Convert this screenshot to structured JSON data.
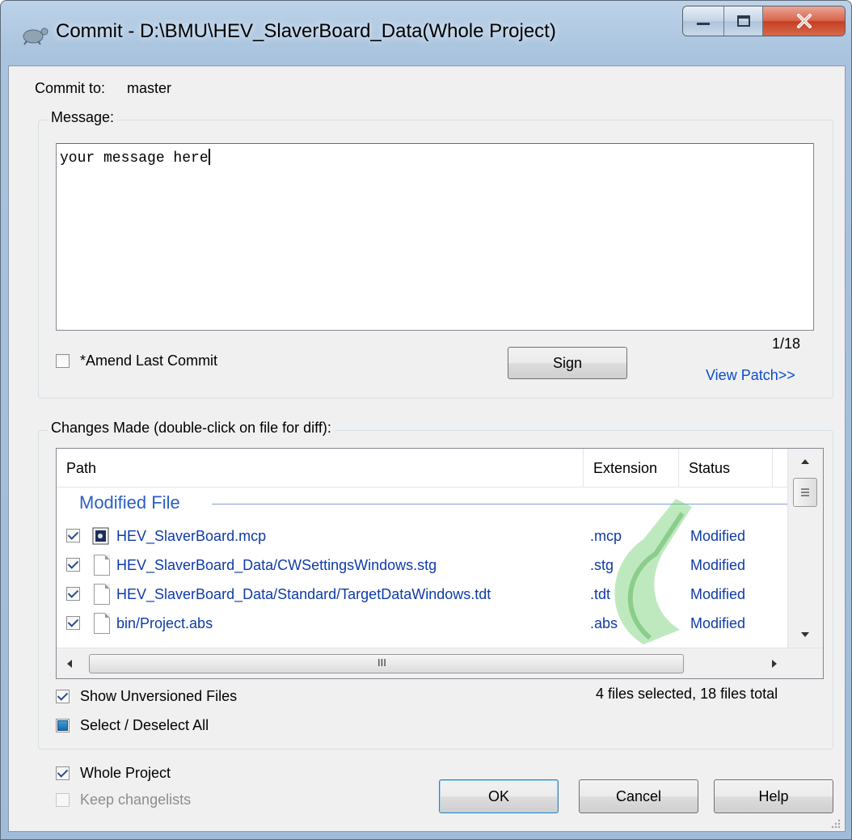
{
  "window": {
    "title": "Commit - D:\\BMU\\HEV_SlaverBoard_Data(Whole Project)",
    "minimize_glyph": "—",
    "maximize_glyph": "□",
    "close_glyph": "✕"
  },
  "commit_to": {
    "label": "Commit to:",
    "value": "master"
  },
  "message": {
    "group_label": "Message:",
    "value": "your message here",
    "counter": "1/18"
  },
  "amend": {
    "label": "*Amend Last Commit",
    "checked": false
  },
  "sign_button": "Sign",
  "view_patch": "View Patch>>",
  "changes": {
    "group_label": "Changes Made (double-click on file for diff):",
    "columns": [
      "Path",
      "Extension",
      "Status"
    ],
    "section_header": "Modified File",
    "rows": [
      {
        "checked": true,
        "path": "HEV_SlaverBoard.mcp",
        "extension": ".mcp",
        "status": "Modified",
        "icon": "project-file-icon"
      },
      {
        "checked": true,
        "path": "HEV_SlaverBoard_Data/CWSettingsWindows.stg",
        "extension": ".stg",
        "status": "Modified",
        "icon": "file-icon"
      },
      {
        "checked": true,
        "path": "HEV_SlaverBoard_Data/Standard/TargetDataWindows.tdt",
        "extension": ".tdt",
        "status": "Modified",
        "icon": "file-icon"
      },
      {
        "checked": true,
        "path": "bin/Project.abs",
        "extension": ".abs",
        "status": "Modified",
        "icon": "file-icon"
      }
    ],
    "hscroll_grip": "III",
    "summary": "4 files selected, 18 files total"
  },
  "show_unversioned": {
    "label": "Show Unversioned Files",
    "checked": true
  },
  "select_all": {
    "label": "Select / Deselect All",
    "state": "indeterminate"
  },
  "whole_project": {
    "label": "Whole Project",
    "checked": true
  },
  "keep_changelists": {
    "label": "Keep changelists",
    "checked": false,
    "disabled": true
  },
  "buttons": {
    "ok": "OK",
    "cancel": "Cancel",
    "help": "Help"
  },
  "colors": {
    "link": "#0b4dcc",
    "file_text": "#0f3ba8",
    "section": "#2a5fc4",
    "watermark": "#3aa83a"
  }
}
